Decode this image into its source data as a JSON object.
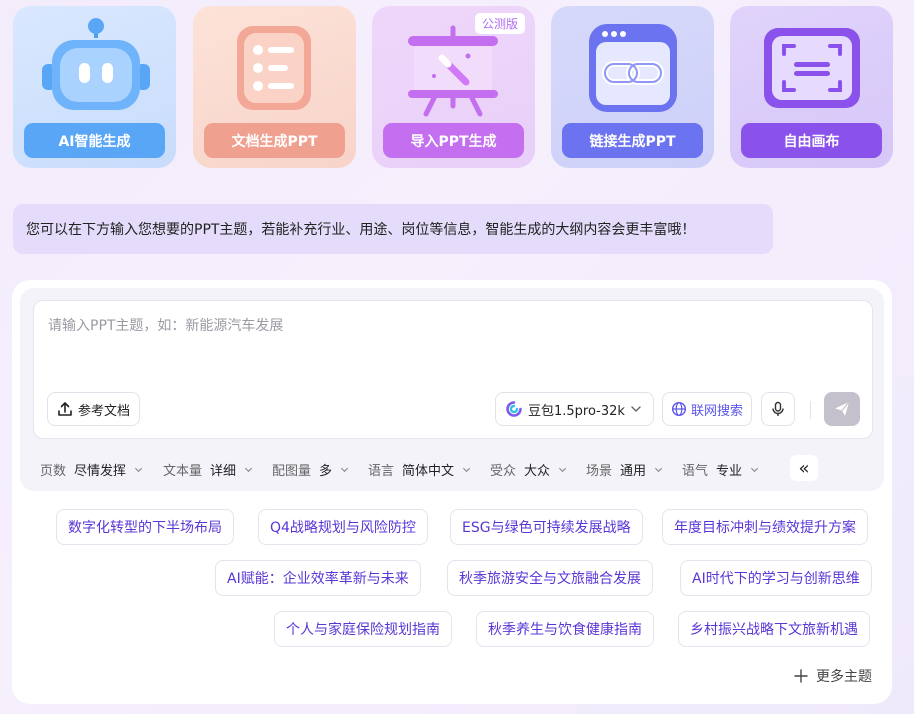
{
  "modes": [
    {
      "label": "AI智能生成",
      "icon": "robot-icon"
    },
    {
      "label": "文档生成PPT",
      "icon": "document-list-icon"
    },
    {
      "label": "导入PPT生成",
      "icon": "presentation-board-icon",
      "badge": "公测版"
    },
    {
      "label": "链接生成PPT",
      "icon": "browser-link-icon"
    },
    {
      "label": "自由画布",
      "icon": "scan-canvas-icon"
    }
  ],
  "hint": "您可以在下方输入您想要的PPT主题，若能补充行业、用途、岗位等信息，智能生成的大纲内容会更丰富哦！",
  "input": {
    "placeholder": "请输入PPT主题，如：新能源汽车发展",
    "value": ""
  },
  "toolbar": {
    "reference_doc": "参考文档",
    "model": "豆包1.5pro-32k",
    "web_search": "联网搜索"
  },
  "options": [
    {
      "label": "页数",
      "value": "尽情发挥"
    },
    {
      "label": "文本量",
      "value": "详细"
    },
    {
      "label": "配图量",
      "value": "多"
    },
    {
      "label": "语言",
      "value": "简体中文"
    },
    {
      "label": "受众",
      "value": "大众"
    },
    {
      "label": "场景",
      "value": "通用"
    },
    {
      "label": "语气",
      "value": "专业"
    }
  ],
  "collapse_symbol": "«",
  "suggestions": [
    "数字化转型的下半场布局",
    "Q4战略规划与风险防控",
    "ESG与绿色可持续发展战略",
    "年度目标冲刺与绩效提升方案",
    "AI赋能：企业效率革新与未来",
    "秋季旅游安全与文旅融合发展",
    "AI时代下的学习与创新思维",
    "个人与家庭保险规划指南",
    "秋季养生与饮食健康指南",
    "乡村振兴战略下文旅新机遇"
  ],
  "more_topics": "更多主题",
  "colors": {
    "accent": "#5a36d6",
    "card_blue": "#5aa6f6",
    "card_peach": "#f0a08e",
    "card_pink": "#c46ef0",
    "card_indigo": "#6b73f0",
    "card_purple": "#8a52ea"
  }
}
